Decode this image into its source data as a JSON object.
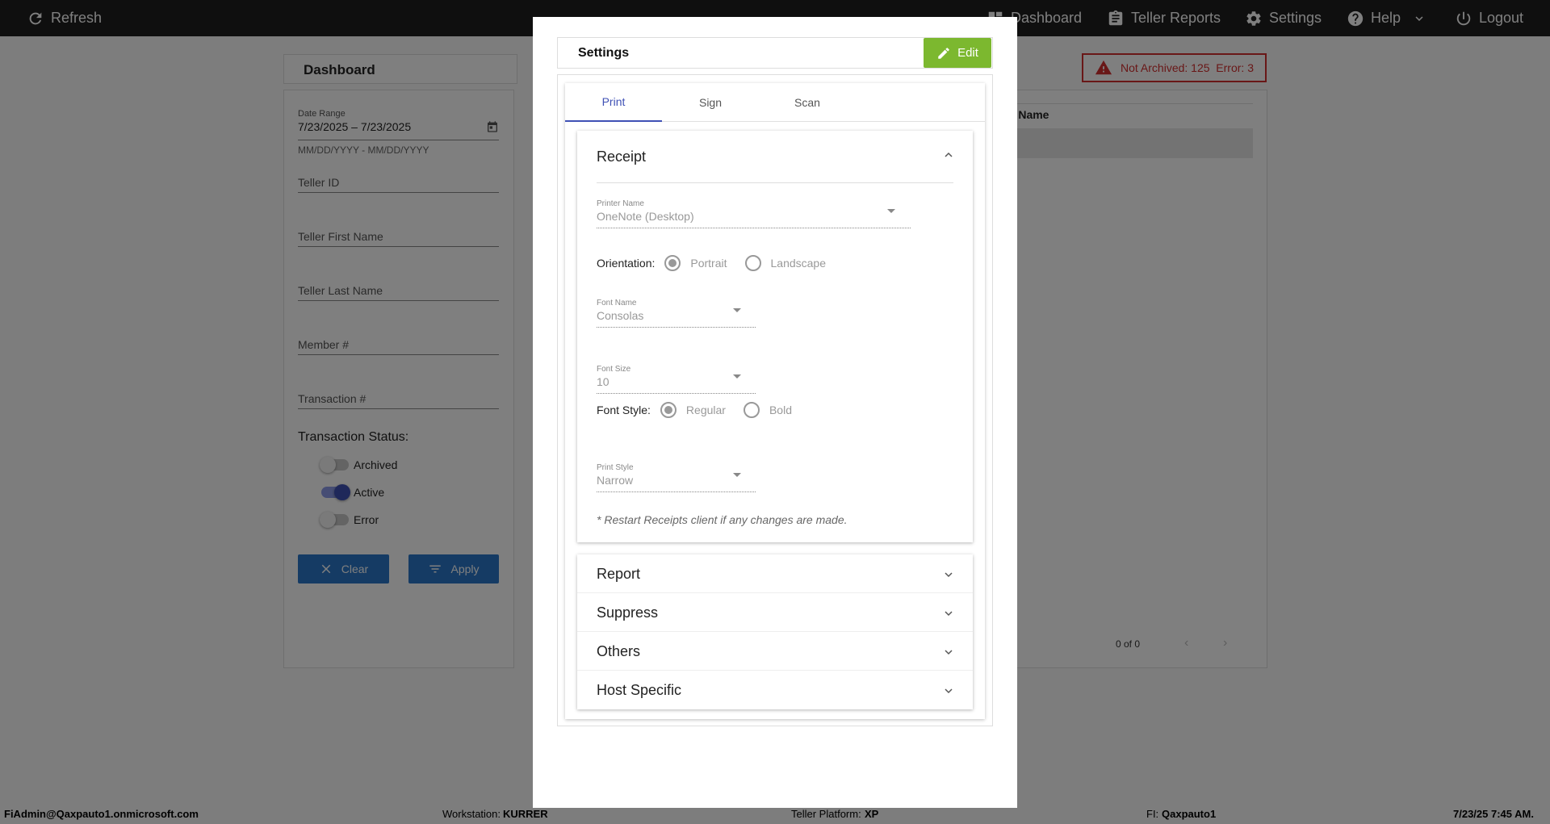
{
  "topbar": {
    "refresh": "Refresh",
    "dashboard": "Dashboard",
    "teller_reports": "Teller Reports",
    "settings": "Settings",
    "help": "Help",
    "logout": "Logout"
  },
  "dashboard": {
    "title": "Dashboard",
    "date_range_label": "Date Range",
    "date_range_value": "7/23/2025 – 7/23/2025",
    "date_hint": "MM/DD/YYYY - MM/DD/YYYY",
    "fields": [
      "Teller ID",
      "Teller First Name",
      "Teller Last Name",
      "Member #",
      "Transaction #"
    ],
    "status_title": "Transaction Status:",
    "toggles": [
      {
        "label": "Archived",
        "on": false
      },
      {
        "label": "Active",
        "on": true
      },
      {
        "label": "Error",
        "on": false
      }
    ],
    "clear": "Clear",
    "apply": "Apply",
    "alert": "Not Archived: 125  Error: 3",
    "column_header": "r Name",
    "pager": "0 of 0"
  },
  "modal": {
    "title": "Settings",
    "edit": "Edit",
    "tabs": [
      "Print",
      "Sign",
      "Scan"
    ],
    "active_tab": "Print",
    "receipt": {
      "title": "Receipt",
      "printer_label": "Printer Name",
      "printer_value": "OneNote (Desktop)",
      "orientation_label": "Orientation:",
      "orientation_options": [
        "Portrait",
        "Landscape"
      ],
      "orientation_selected": "Portrait",
      "font_name_label": "Font Name",
      "font_name_value": "Consolas",
      "font_size_label": "Font Size",
      "font_size_value": "10",
      "font_style_label": "Font Style:",
      "font_style_options": [
        "Regular",
        "Bold"
      ],
      "font_style_selected": "Regular",
      "print_style_label": "Print Style",
      "print_style_value": "Narrow",
      "note": "* Restart Receipts client if any changes are made."
    },
    "sections": [
      "Report",
      "Suppress",
      "Others",
      "Host Specific"
    ]
  },
  "footer": {
    "user": "FiAdmin@Qaxpauto1.onmicrosoft.com",
    "workstation_label": "Workstation:",
    "workstation": "KURRER",
    "platform_label": "Teller Platform:",
    "platform": "XP",
    "fi_label": "FI:",
    "fi": "Qaxpauto1",
    "timestamp": "7/23/25 7:45 AM."
  },
  "colors": {
    "topbar": "#1f1f1f",
    "accent": "#3f51b5",
    "edit_button": "#7cb82f",
    "primary_button": "#2a77c8",
    "alert": "#d32f2f"
  }
}
